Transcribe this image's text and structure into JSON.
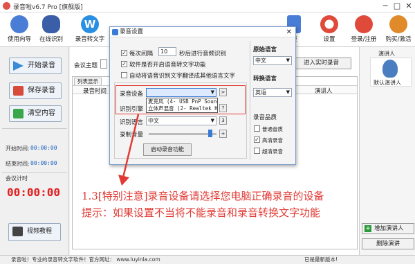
{
  "window": {
    "title": "录音啦v6.7 Pro [旗舰版]",
    "min": "─",
    "max": "□",
    "close": "✕"
  },
  "toolbar": [
    {
      "label": "使用向导",
      "color": "#4a7dd6"
    },
    {
      "label": "在线识别",
      "color": "#3a5fa8"
    },
    {
      "label": "录音转文字",
      "color": "#2a8fe0"
    }
  ],
  "toolbar_right": [
    {
      "label": "服",
      "color": "#4a7dd6"
    },
    {
      "label": "设置",
      "color": "#3a8fd6"
    },
    {
      "label": "登录/注册",
      "color": "#e04a3a"
    },
    {
      "label": "购买/激活",
      "color": "#e08a2a"
    }
  ],
  "left": {
    "start": "开始录音",
    "save": "保存录音",
    "clear": "清空内容",
    "start_time_label": "开始时间:",
    "start_time": "00:00:00",
    "end_time_label": "结束时间:",
    "end_time": "00:00:00",
    "timer_label": "会议计时",
    "timer": "00:00:00",
    "video": "视频教程"
  },
  "main": {
    "meeting_topic_label": "会议主题",
    "tab": "列表显示",
    "col_a": "A",
    "col_time": "录音时间",
    "col_speaker": "演讲人",
    "realtime_btn": "进入实时录音"
  },
  "right": {
    "speaker_label": "演讲人",
    "default_speaker": "默认演讲人",
    "add_speaker": "增加演讲人",
    "delete_speaker": "删除演讲"
  },
  "dialog": {
    "title": "录音设置",
    "interval_label": "每次间隔",
    "interval_value": "10",
    "interval_suffix": "秒后进行音频识别",
    "opt_voice_text": "软件是否开启语音转文字功能",
    "opt_auto_translate": "自动将语音识别文字翻译成其他语言文字",
    "device_label": "录音设备",
    "device_option1": "麦克风 (4- USB PnP Sound",
    "device_option2": "立体声混音 (2- Realtek Hi",
    "engine_label": "识别引擎",
    "lang_label": "识别语言",
    "lang_value": "中文",
    "volume_label": "录制音量",
    "start_btn": "启动录音功能",
    "source_lang_label": "原始语言",
    "source_lang": "中文",
    "target_lang_label": "转换语言",
    "target_lang": "英语",
    "quality_label": "录音品质",
    "q_normal": "普通音质",
    "q_high": "高清录音",
    "q_ultra": "超清录音",
    "btn_help1": "?",
    "btn_help2": "?",
    "btn_3": "3",
    "btn_plus": "+",
    "btn_arrow": ">"
  },
  "annotation": {
    "line1": "1.3[特别注意]录音设备请选择您电脑正确录音的设备",
    "line2": "提示：如果设置不当将不能录音和录音转换文字功能"
  },
  "status": {
    "left": "录音啦！专业的录音转文字软件！官方网址： www.luyinla.com",
    "right": "已是最新版本!"
  },
  "colors": {
    "accent_red": "#e03a34",
    "timer_red": "#e02020",
    "blue": "#1860c0"
  }
}
